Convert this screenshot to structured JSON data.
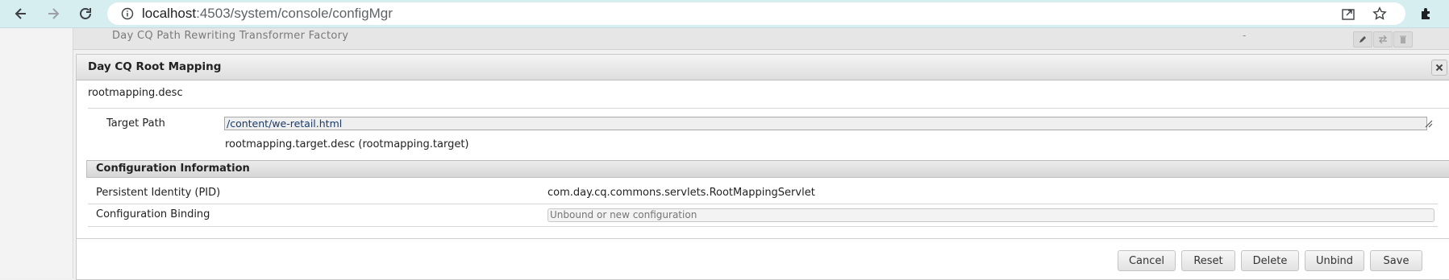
{
  "browser": {
    "url_host": "localhost",
    "url_rest": ":4503/system/console/configMgr"
  },
  "background_row": {
    "name": "Day CQ Path Rewriting Transformer Factory",
    "value": "-"
  },
  "dialog": {
    "title": "Day CQ Root Mapping",
    "description": "rootmapping.desc",
    "target_path_label": "Target Path",
    "target_path_value": "/content/we-retail.html",
    "target_path_hint": "rootmapping.target.desc (rootmapping.target)",
    "config_info_header": "Configuration Information",
    "pid_label": "Persistent Identity (PID)",
    "pid_value": "com.day.cq.commons.servlets.RootMappingServlet",
    "binding_label": "Configuration Binding",
    "binding_placeholder": "Unbound or new configuration"
  },
  "buttons": {
    "cancel": "Cancel",
    "reset": "Reset",
    "delete": "Delete",
    "unbind": "Unbind",
    "save": "Save"
  },
  "colors": {
    "browser_bar": "#d6eef0",
    "dialog_title_bg": "#dedede",
    "input_text": "#1a3a6a"
  }
}
